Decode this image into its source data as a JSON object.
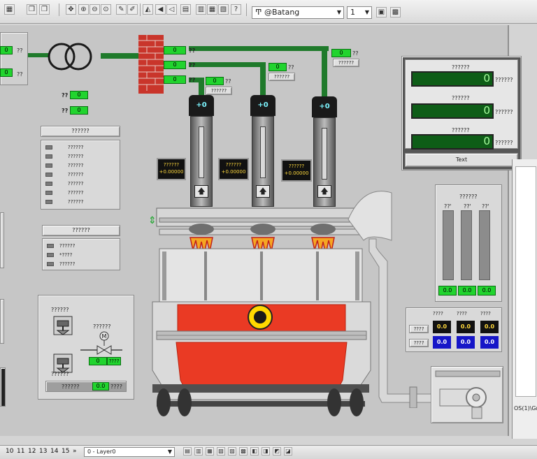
{
  "toolbar": {
    "font_select": "Ͳ @Batang",
    "size_select": "1"
  },
  "left_edge": {
    "val_1": "0",
    "val_2": "0",
    "lbl_1": "??",
    "lbl_2": "??"
  },
  "transformer_feeds": [
    {
      "value": "0",
      "label": "??"
    },
    {
      "value": "0",
      "label": "??"
    },
    {
      "value": "0",
      "label": "??"
    }
  ],
  "feed_tags": [
    {
      "value": "0",
      "label": "??",
      "tag": "??????"
    },
    {
      "value": "0",
      "label": "??",
      "tag": "??????"
    },
    {
      "value": "0",
      "label": "??",
      "tag": "??????"
    }
  ],
  "small_pairs": [
    {
      "label": "??",
      "value": "0"
    },
    {
      "label": "??",
      "value": "0"
    }
  ],
  "list_panel_1": {
    "title": "??????",
    "rows": [
      "??????",
      "??????",
      "??????",
      "??????",
      "??????",
      "??????",
      "??????"
    ]
  },
  "list_panel_2": {
    "title": "??????",
    "rows": [
      "??????",
      "*????",
      "??????"
    ]
  },
  "valve_panel": {
    "label_1": "??????",
    "label_2": "??????",
    "label_3": "??????",
    "value": "0",
    "value_unit": "????",
    "bottom_label": "??????",
    "bottom_value": "0.0",
    "bottom_unit": "????",
    "motor_symbol": "M"
  },
  "electrodes": [
    {
      "reading": "+0",
      "label": "??????",
      "value": "+0.00000"
    },
    {
      "reading": "+0",
      "label": "??????",
      "value": "+0.00000"
    },
    {
      "reading": "+0",
      "label": "??????",
      "value": "+0.00000"
    }
  ],
  "meter_panel": {
    "meters": [
      {
        "title": "??????",
        "value": "0",
        "unit": "??????"
      },
      {
        "title": "??????",
        "value": "0",
        "unit": "??????"
      },
      {
        "title": "??????",
        "value": "0",
        "unit": "??????"
      }
    ],
    "button": "Text"
  },
  "bar_panel": {
    "title": "??????",
    "bar_labels": [
      "??'",
      "??'",
      "??'"
    ],
    "values": [
      "0.0",
      "0.0",
      "0.0"
    ]
  },
  "value_table": {
    "headers": [
      "????",
      "????",
      "????"
    ],
    "row_labels": [
      "????",
      "????"
    ],
    "yellow": [
      "0.0",
      "0.0",
      "0.0"
    ],
    "blue": [
      "0.0",
      "0.0",
      "0.0"
    ]
  },
  "bottom": {
    "pages": [
      "10",
      "11",
      "12",
      "13",
      "14",
      "15"
    ],
    "layer_select": "0 - Layer0"
  },
  "right_panel": {
    "path": "OS(1)\\Gr"
  },
  "colors": {
    "pipe_green": "#1f7a2b",
    "value_green": "#21d42e",
    "lcd_green": "#0e5d17",
    "furnace_red": "#ea3a24",
    "value_blue": "#1616c8"
  }
}
